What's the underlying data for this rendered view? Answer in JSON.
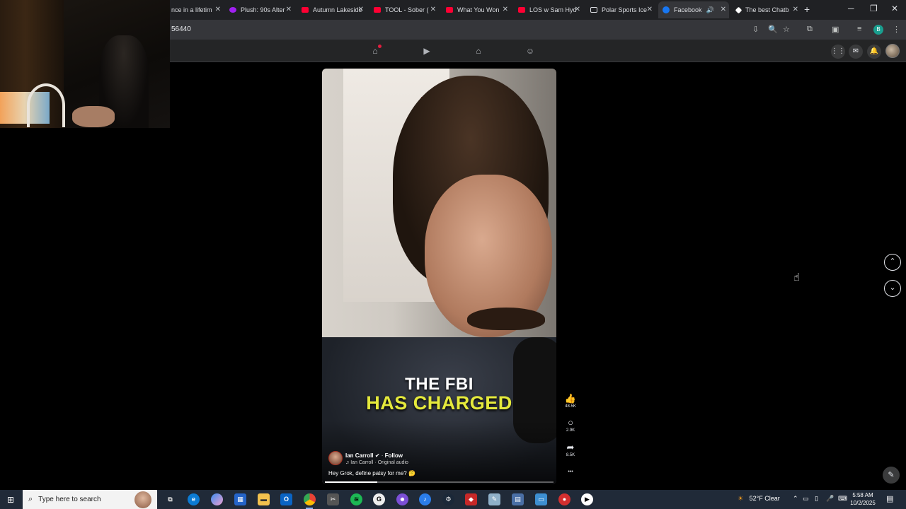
{
  "browser": {
    "tabs": [
      {
        "title": "nce in a lifetim",
        "icon": "none"
      },
      {
        "title": "Plush: 90s Alter",
        "icon": "plush"
      },
      {
        "title": "Autumn Lakeside",
        "icon": "youtube"
      },
      {
        "title": "TOOL - Sober (",
        "icon": "youtube"
      },
      {
        "title": "What You Won",
        "icon": "youtube"
      },
      {
        "title": "LOS w Sam Hyd",
        "icon": "youtube"
      },
      {
        "title": "Polar Sports Ice",
        "icon": "doc"
      },
      {
        "title": "Facebook",
        "icon": "facebook",
        "active": true
      },
      {
        "title": "The best Chatb",
        "icon": "diamond"
      }
    ],
    "close_glyph": "✕",
    "new_tab_glyph": "+",
    "url_fragment": "56440",
    "profile_letter": "B",
    "window_controls": {
      "minimize": "─",
      "restore": "❐",
      "close": "✕"
    }
  },
  "facebook": {
    "nav_icons": [
      "home-icon",
      "video-icon",
      "marketplace-icon",
      "groups-icon"
    ],
    "right_icons": [
      "menu-grid-icon",
      "messenger-icon",
      "notifications-icon",
      "profile-avatar"
    ]
  },
  "reel": {
    "caption_line1": "THE FBI",
    "caption_line2": "HAS CHARGED",
    "author": "Ian Carroll",
    "verified": "✔",
    "separator": "·",
    "follow_label": "Follow",
    "audio": "♫ Ian Carroll · Original audio",
    "description": "Hey Grok, define patsy for me? 🤔",
    "progress_fraction": 0.23,
    "likes": "48.5K",
    "comments": "2.9K",
    "shares": "8.5K",
    "more_glyph": "•••"
  },
  "navigation": {
    "prev_glyph": "⌃",
    "next_glyph": "⌄"
  },
  "taskbar": {
    "search_placeholder": "Type here to search",
    "weather_temp": "52°F",
    "weather_text": "Clear",
    "time": "5:58 AM",
    "date": "10/2/2025"
  },
  "colors": {
    "facebook_blue": "#1877f2",
    "youtube_red": "#ff0033",
    "caption_yellow": "#e5ea3c",
    "taskbar_bg": "#202a38"
  }
}
